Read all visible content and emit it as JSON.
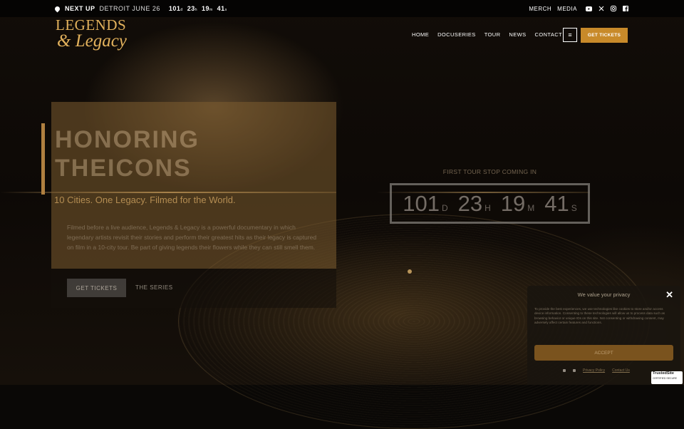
{
  "topbar": {
    "next_up_label": "NEXT UP",
    "next_up_city": "DETROIT JUNE 26",
    "countdown": [
      {
        "value": "101",
        "unit": "d"
      },
      {
        "value": "23",
        "unit": "h"
      },
      {
        "value": "19",
        "unit": "m"
      },
      {
        "value": "41",
        "unit": "s"
      }
    ],
    "links": [
      "MERCH",
      "MEDIA"
    ],
    "social_icons": [
      "youtube-icon",
      "x-icon",
      "instagram-icon",
      "facebook-icon"
    ]
  },
  "logo": {
    "line1": "LEGENDS",
    "line2": "& Legacy"
  },
  "nav": {
    "items": [
      "HOME",
      "DOCUSERIES",
      "TOUR",
      "NEWS",
      "CONTACT"
    ],
    "menu_icon": "≡",
    "cta": "GET TICKETS"
  },
  "hero": {
    "title_line1": "HONORING",
    "title_line2": "THEICONS",
    "tagline": "10 Cities. One Legacy. Filmed for the World.",
    "description": "Filmed before a live audience, Legends & Legacy is a powerful documentary in which legendary artists revisit their stories and perform their greatest hits as their legacy is captured on film in a 10-city tour. Be part of giving legends their flowers while they can still smell them.",
    "primary_button": "GET TICKETS",
    "secondary_button": "THE SERIES"
  },
  "countdown": {
    "title": "FIRST TOUR STOP COMING IN",
    "items": [
      {
        "value": "101",
        "unit": "D"
      },
      {
        "value": "23",
        "unit": "H"
      },
      {
        "value": "19",
        "unit": "M"
      },
      {
        "value": "41",
        "unit": "S"
      }
    ]
  },
  "consent": {
    "title": "We value your privacy",
    "text": "To provide the best experiences, we use technologies like cookies to store and/or access device information. Consenting to these technologies will allow us to process data such as browsing behavior or unique IDs on this site. Not consenting or withdrawing consent, may adversely affect certain features and functions.",
    "accept": "ACCEPT",
    "links": [
      "Privacy Policy",
      "Contact Us"
    ]
  },
  "trusted": {
    "line1": "TrustedSite",
    "line2": "CERTIFIED SECURE"
  },
  "colors": {
    "accent": "#c88a2a",
    "logo": "#e2b15c"
  }
}
